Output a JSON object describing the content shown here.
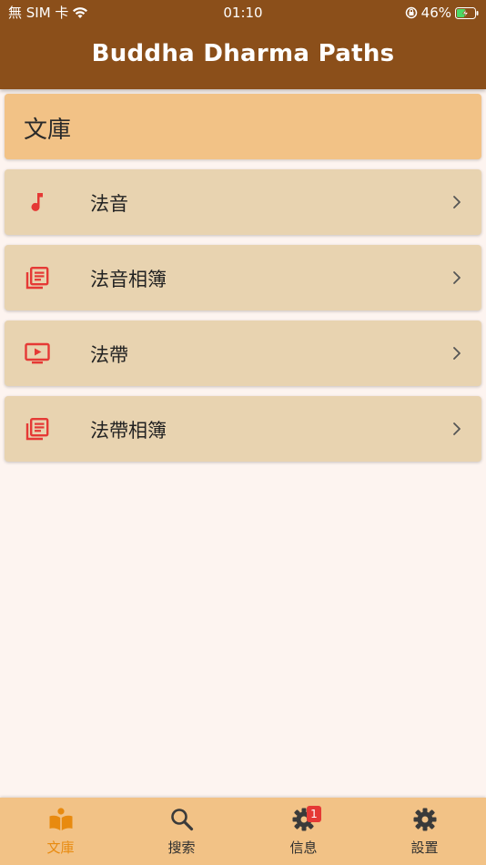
{
  "status_bar": {
    "carrier": "無 SIM 卡",
    "time": "01:10",
    "battery": "46%"
  },
  "app_bar": {
    "title": "Buddha Dharma Paths"
  },
  "library": {
    "header": "文庫",
    "items": [
      {
        "label": "法音",
        "icon": "music-note-icon"
      },
      {
        "label": "法音相簿",
        "icon": "library-books-icon"
      },
      {
        "label": "法帶",
        "icon": "video-screen-icon"
      },
      {
        "label": "法帶相簿",
        "icon": "library-books-icon"
      }
    ]
  },
  "bottom_nav": {
    "tabs": [
      {
        "label": "文庫",
        "icon": "open-book-person-icon",
        "active": true
      },
      {
        "label": "搜索",
        "icon": "search-icon"
      },
      {
        "label": "信息",
        "icon": "message-gear-icon",
        "badge": "1"
      },
      {
        "label": "設置",
        "icon": "gear-icon"
      }
    ]
  },
  "colors": {
    "app_bar": "#8b4f1a",
    "section_header": "#f2c286",
    "card": "#e8d3b0",
    "icon_red": "#e53935",
    "active_tab": "#e88a0f",
    "background": "#fdf4f0"
  }
}
